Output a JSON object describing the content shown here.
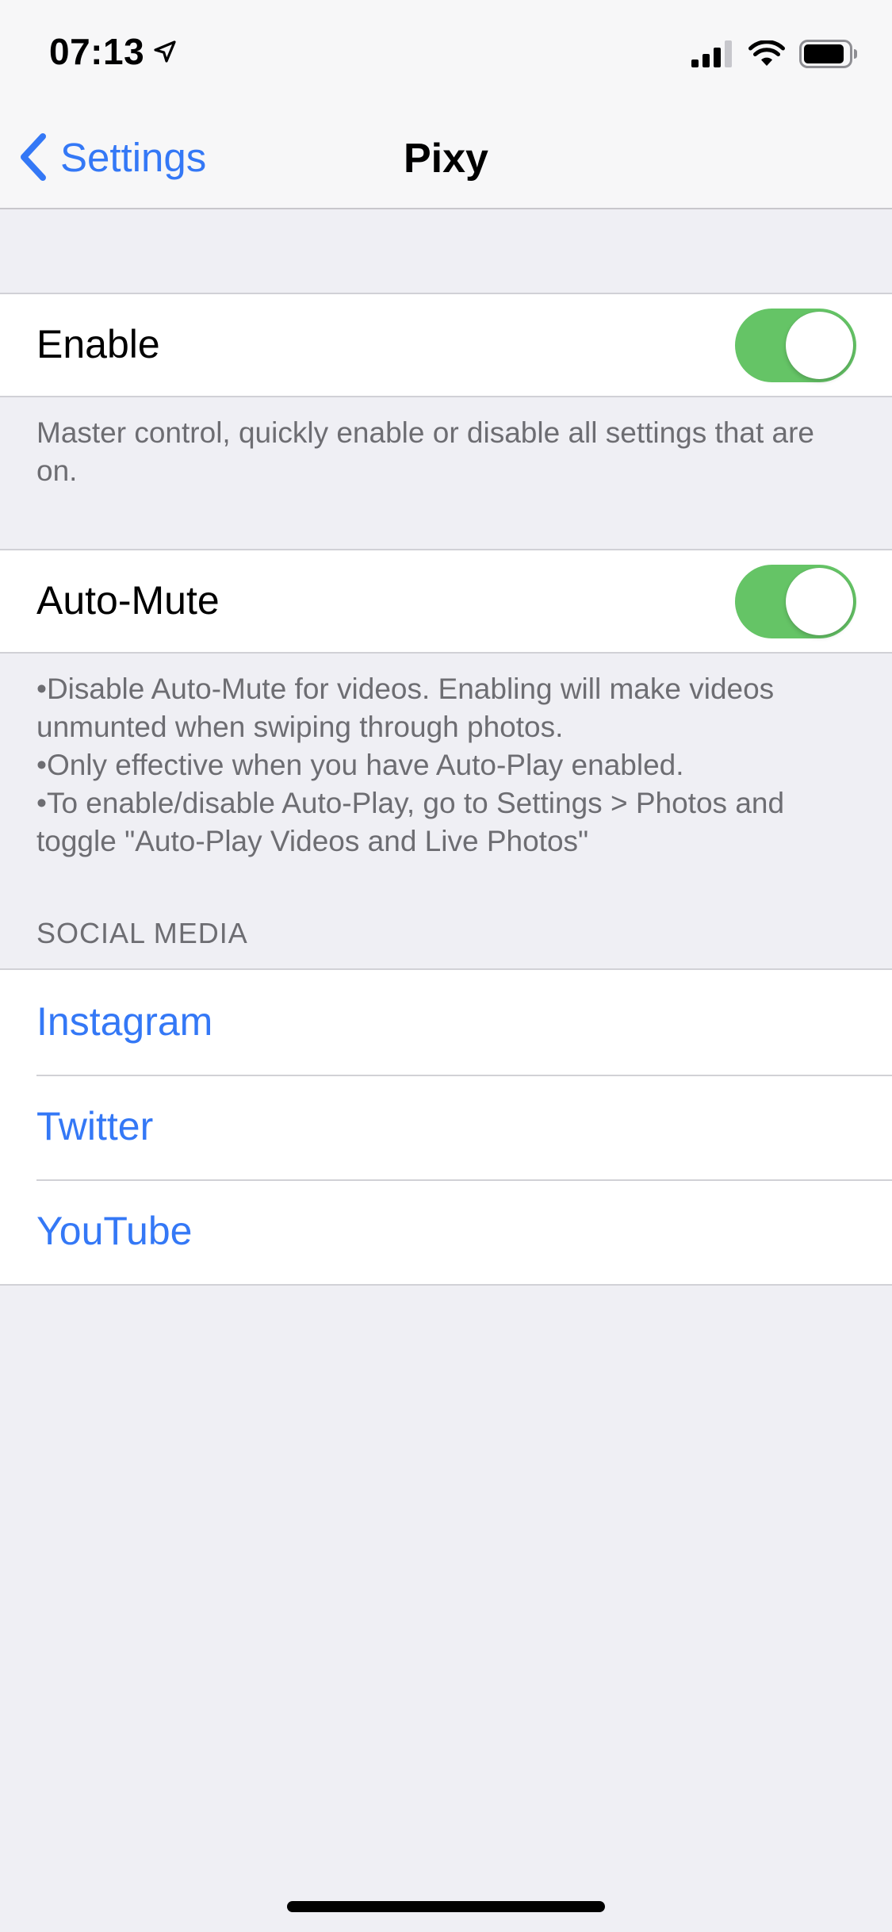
{
  "status_bar": {
    "time": "07:13",
    "location_icon": "location-arrow-icon",
    "signal_icon": "cellular-signal-icon",
    "wifi_icon": "wifi-icon",
    "battery_icon": "battery-icon"
  },
  "nav": {
    "back_label": "Settings",
    "title": "Pixy"
  },
  "enable": {
    "label": "Enable",
    "state": true,
    "footer": "Master control, quickly enable or disable all settings that are on."
  },
  "automute": {
    "label": "Auto-Mute",
    "state": true,
    "footer_lines": [
      "•Disable Auto-Mute for videos. Enabling will make videos unmunted when swiping through photos.",
      "•Only effective when you have Auto-Play enabled.",
      "•To enable/disable Auto-Play, go to Settings > Photos and toggle \"Auto-Play Videos and Live Photos\""
    ]
  },
  "social": {
    "header": "SOCIAL MEDIA",
    "links": [
      "Instagram",
      "Twitter",
      "YouTube"
    ]
  },
  "colors": {
    "accent": "#3478f6",
    "toggle_on": "#65c466",
    "background": "#efeff4"
  }
}
